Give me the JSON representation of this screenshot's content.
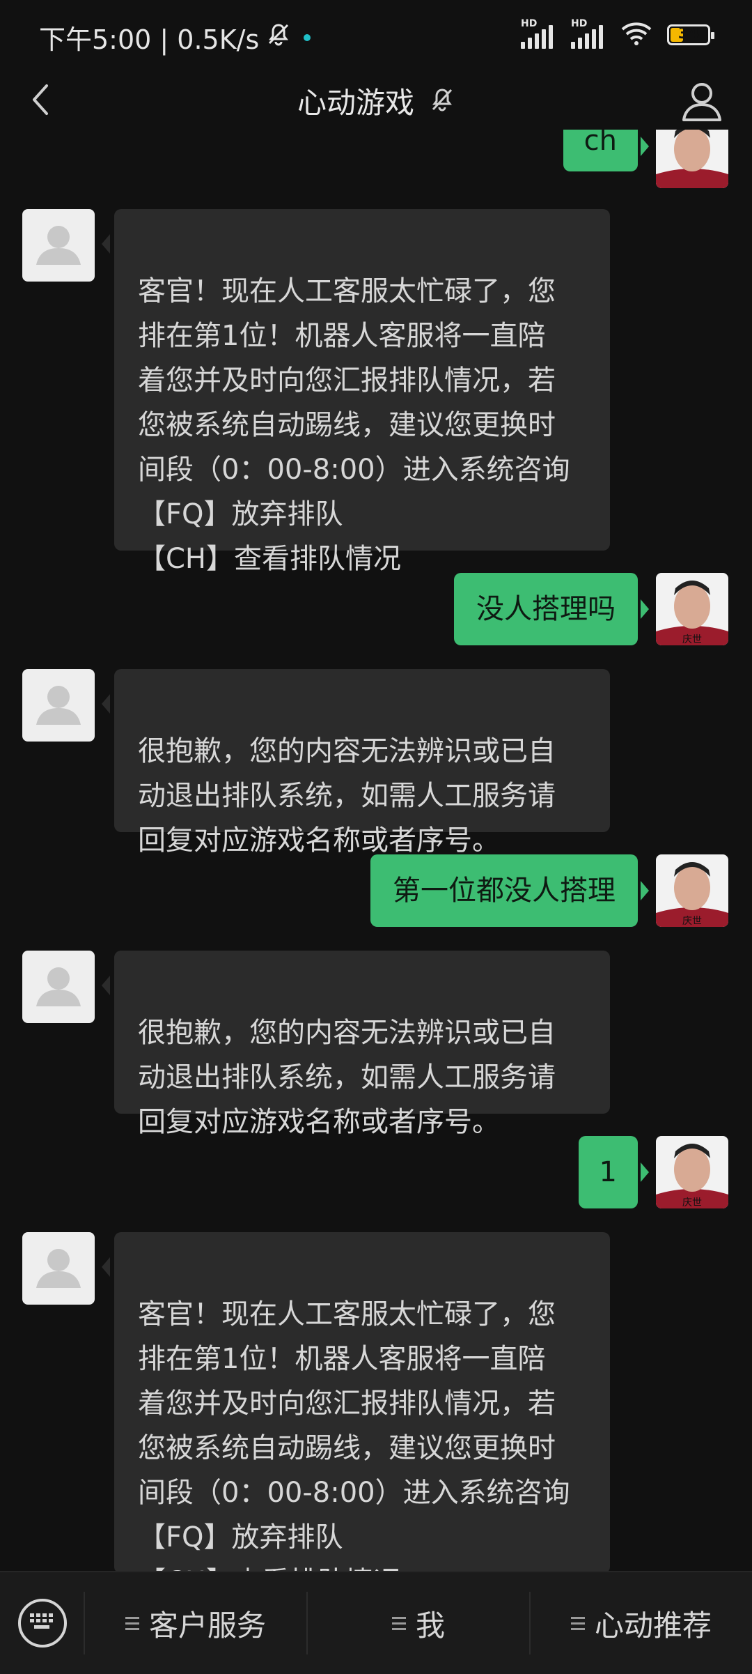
{
  "status_bar": {
    "time_speed": "下午5:00 | 0.5K/s",
    "hd_label": "HD",
    "battery": "34",
    "battery_level": 0.34,
    "accent_dot_color": "#20c0c8"
  },
  "header": {
    "title": "心动游戏",
    "back_icon": "chevron-left-icon",
    "mute_icon": "bell-off-icon",
    "profile_icon": "person-icon"
  },
  "user": {
    "avatar_caption": "庆世"
  },
  "messages": [
    {
      "from": "user",
      "text": "ch"
    },
    {
      "from": "bot",
      "text": "客官！现在人工客服太忙碌了，您\n排在第1位！机器人客服将一直陪\n着您并及时向您汇报排队情况，若\n您被系统自动踢线，建议您更换时\n间段（0：00-8:00）进入系统咨询\n【FQ】放弃排队\n【CH】查看排队情况"
    },
    {
      "from": "user",
      "text": "没人搭理吗"
    },
    {
      "from": "bot",
      "text": "很抱歉，您的内容无法辨识或已自\n动退出排队系统，如需人工服务请\n回复对应游戏名称或者序号。"
    },
    {
      "from": "user",
      "text": "第一位都没人搭理"
    },
    {
      "from": "bot",
      "text": "很抱歉，您的内容无法辨识或已自\n动退出排队系统，如需人工服务请\n回复对应游戏名称或者序号。"
    },
    {
      "from": "user",
      "text": "1"
    },
    {
      "from": "bot",
      "text": "客官！现在人工客服太忙碌了，您\n排在第1位！机器人客服将一直陪\n着您并及时向您汇报排队情况，若\n您被系统自动踢线，建议您更换时\n间段（0：00-8:00）进入系统咨询\n【FQ】放弃排队\n【CH】查看排队情况"
    }
  ],
  "bottom_menu": {
    "keyboard_icon": "keyboard-icon",
    "items": [
      "客户服务",
      "我",
      "心动推荐"
    ]
  },
  "colors": {
    "background": "#111111",
    "bubble_in": "#2b2b2b",
    "bubble_out": "#3dbd72"
  }
}
